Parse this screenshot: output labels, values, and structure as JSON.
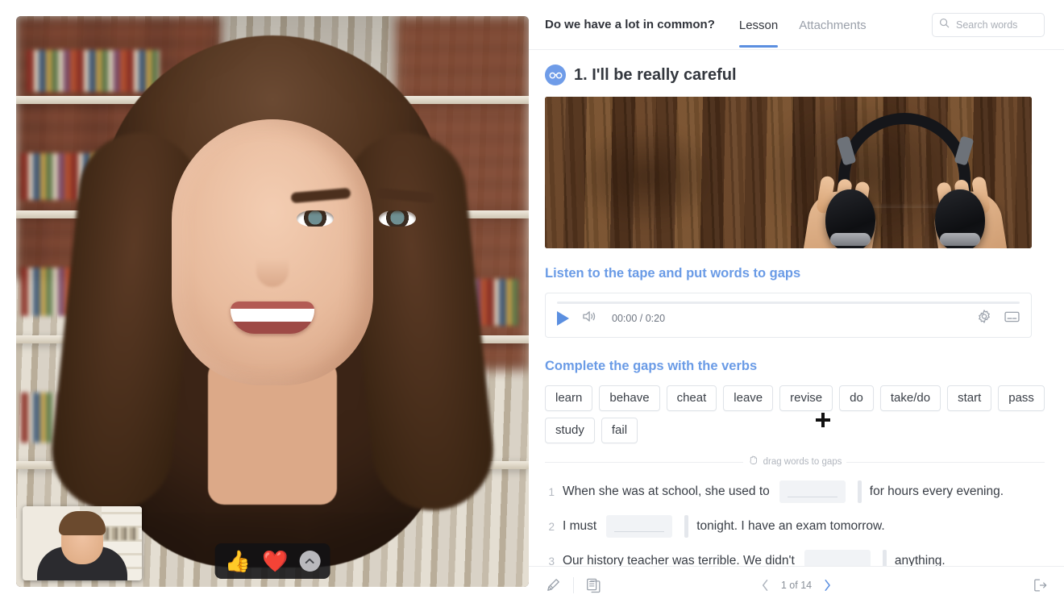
{
  "header": {
    "lesson_name": "Do we have a lot in common?",
    "tabs": [
      {
        "label": "Lesson",
        "active": true
      },
      {
        "label": "Attachments",
        "active": false
      }
    ],
    "search": {
      "placeholder": "Search words",
      "value": "",
      "icon": "search-icon"
    }
  },
  "exercise": {
    "badge_icon": "glasses-icon",
    "title": "1. I'll be really careful",
    "image_alt": "hands holding black headphones on a wooden table"
  },
  "audio_section": {
    "title": "Listen to the tape and put words to gaps",
    "player": {
      "play_icon": "play-icon",
      "volume_icon": "volume-icon",
      "time": "00:00 / 0:20",
      "settings_icon": "gear-icon",
      "captions_icon": "captions-icon",
      "progress_percent": 0
    }
  },
  "gap_exercise": {
    "title": "Complete the gaps with the verbs",
    "words": [
      "learn",
      "behave",
      "cheat",
      "leave",
      "revise",
      "do",
      "take/do",
      "start",
      "pass",
      "study",
      "fail"
    ],
    "drag_hint": "drag words to gaps",
    "drag_hint_icon": "grab-hand-icon",
    "sentences": [
      {
        "number": "1",
        "before": "When she was at school, she used to",
        "gap_value": "",
        "after": "for hours every evening."
      },
      {
        "number": "2",
        "before": "I must",
        "gap_value": "",
        "after": "tonight. I have an exam tomorrow."
      },
      {
        "number": "3",
        "before": "Our history teacher was terrible. We didn't",
        "gap_value": "",
        "after": "anything."
      }
    ]
  },
  "footer": {
    "annotate_icon": "pen-icon",
    "pages_icon": "pages-icon",
    "prev_icon": "chevron-left-icon",
    "page_label": "1 of 14",
    "next_icon": "chevron-right-icon",
    "exit_icon": "exit-icon"
  },
  "video": {
    "reactions": [
      {
        "name": "thumbs-up-reaction",
        "glyph": "👍"
      },
      {
        "name": "heart-reaction",
        "glyph": "❤️"
      }
    ],
    "more_reactions_icon": "chevron-up-icon",
    "more_glyph": "▲",
    "remote_participant_alt": "smiling woman with curly hair",
    "self_view_alt": "self view of a young man"
  },
  "colors": {
    "accent_blue": "#5b8fe0",
    "section_blue": "#6a9be6",
    "text_dark": "#33373e",
    "text_muted": "#9aa0aa",
    "chip_border": "#dfe3e8",
    "gap_fill": "#f1f3f6"
  }
}
